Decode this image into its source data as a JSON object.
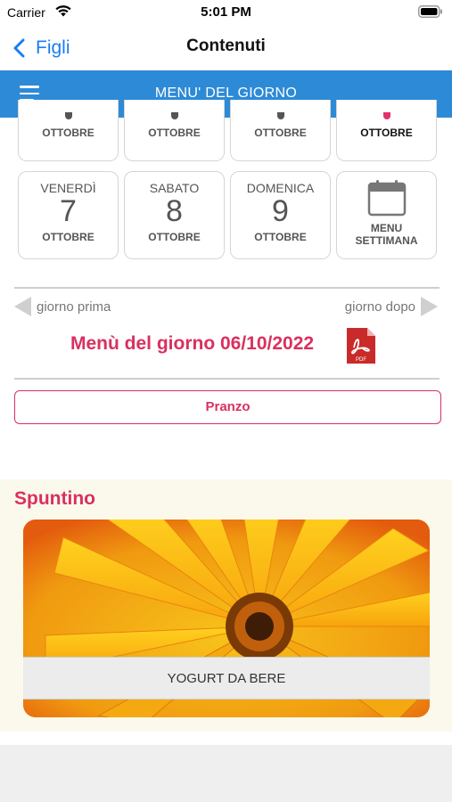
{
  "status_bar": {
    "carrier": "Carrier",
    "time": "5:01 PM"
  },
  "nav": {
    "back_label": "Figli",
    "title": "Contenuti"
  },
  "header": {
    "title": "MENU' DEL GIORNO",
    "color": "#2d8ad6"
  },
  "days_top_row": [
    {
      "month": "OTTOBRE",
      "selected": false
    },
    {
      "month": "OTTOBRE",
      "selected": false
    },
    {
      "month": "OTTOBRE",
      "selected": false
    },
    {
      "month": "OTTOBRE",
      "selected": true
    }
  ],
  "days_bottom_row": [
    {
      "dow": "VENERDÌ",
      "num": "7",
      "month": "OTTOBRE"
    },
    {
      "dow": "SABATO",
      "num": "8",
      "month": "OTTOBRE"
    },
    {
      "dow": "DOMENICA",
      "num": "9",
      "month": "OTTOBRE"
    }
  ],
  "week_menu": {
    "line1": "MENU",
    "line2": "SETTIMANA"
  },
  "day_nav": {
    "prev": "giorno prima",
    "next": "giorno dopo"
  },
  "menu_date": "Menù del giorno 06/10/2022",
  "pdf_icon": "pdf-icon",
  "pranzo_button": "Pranzo",
  "spuntino": {
    "title": "Spuntino",
    "item": "YOGURT DA BERE"
  },
  "colors": {
    "accent": "#d9305f",
    "nav_blue": "#1a7cf5"
  }
}
